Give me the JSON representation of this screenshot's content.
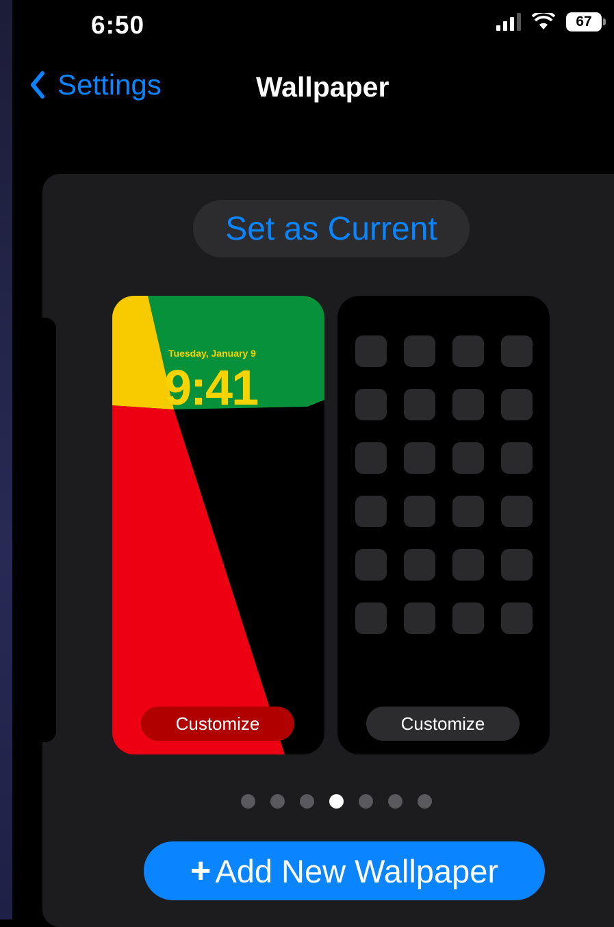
{
  "status_bar": {
    "time": "6:50",
    "battery": "67",
    "icons": [
      "cellular-signal-icon",
      "wifi-icon",
      "battery-icon"
    ]
  },
  "nav": {
    "back_label": "Settings",
    "title": "Wallpaper",
    "back_icon": "chevron-left-icon"
  },
  "card": {
    "set_current_label": "Set as Current",
    "lock_screen": {
      "date": "Tuesday, January 9",
      "time": "9:41",
      "customize_label": "Customize",
      "colors": [
        "#f7cb00",
        "#07913b",
        "#ec0012",
        "#000000"
      ]
    },
    "home_screen": {
      "customize_label": "Customize",
      "app_rows": 6,
      "app_columns": 4
    },
    "page_dots": {
      "count": 7,
      "active_index": 3
    },
    "add_button": {
      "icon": "plus-icon",
      "label": "Add New Wallpaper"
    }
  },
  "colors": {
    "accent": "#0a84ff",
    "card_bg": "#1c1c1e"
  }
}
